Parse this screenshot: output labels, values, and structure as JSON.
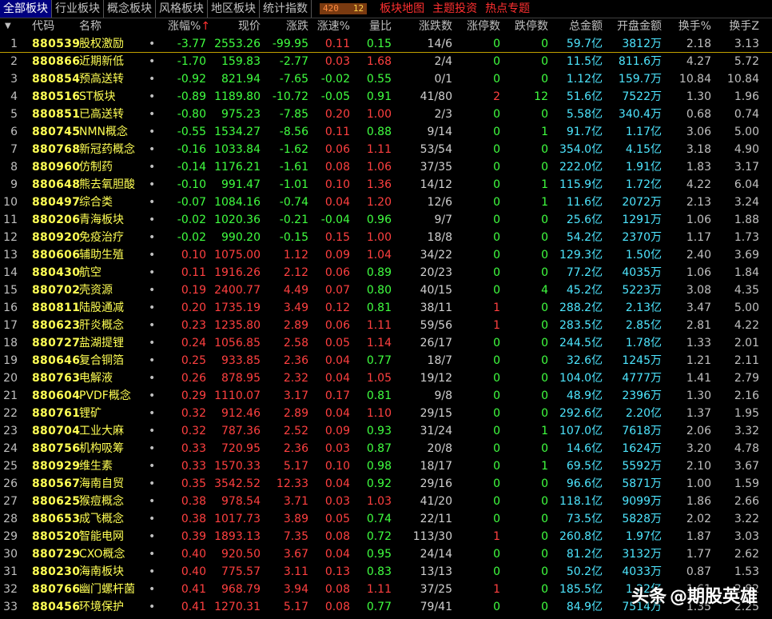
{
  "tabs": [
    "全部板块",
    "行业板块",
    "概念板块",
    "风格板块",
    "地区板块",
    "统计指数"
  ],
  "counter": {
    "a": "420",
    "b": "12"
  },
  "links": [
    "板块地图",
    "主题投资",
    "热点专题"
  ],
  "columns": {
    "code": "代码",
    "name": "名称",
    "pct": "涨幅%",
    "pct_arrow": "↑",
    "price": "现价",
    "chg": "涨跌",
    "spd": "涨速%",
    "vr": "量比",
    "cnt": "涨跌数",
    "ztm": "涨停数",
    "dtm": "跌停数",
    "amt": "总金额",
    "opn": "开盘金额",
    "hs": "换手%",
    "hs2": "换手Z",
    "caret": "▼"
  },
  "rows": [
    {
      "i": "1",
      "code": "880539",
      "name": "股权激励",
      "dot": "•",
      "pct": "-3.77",
      "price": "2553.26",
      "chg": "-99.95",
      "spd": "0.11",
      "vr": "0.15",
      "cnt": "14/6",
      "ztm": "0",
      "dtm": "0",
      "amt": "59.7亿",
      "opn": "3812万",
      "hs": "2.18",
      "hs2": "3.13"
    },
    {
      "i": "2",
      "code": "880866",
      "name": "近期新低",
      "dot": "•",
      "pct": "-1.70",
      "price": "159.83",
      "chg": "-2.77",
      "spd": "0.03",
      "vr": "1.68",
      "cnt": "2/4",
      "ztm": "0",
      "dtm": "0",
      "amt": "11.5亿",
      "opn": "811.6万",
      "hs": "4.27",
      "hs2": "5.72"
    },
    {
      "i": "3",
      "code": "880854",
      "name": "预高送转",
      "dot": "•",
      "pct": "-0.92",
      "price": "821.94",
      "chg": "-7.65",
      "spd": "-0.02",
      "vr": "0.55",
      "cnt": "0/1",
      "ztm": "0",
      "dtm": "0",
      "amt": "1.12亿",
      "opn": "159.7万",
      "hs": "10.84",
      "hs2": "10.84"
    },
    {
      "i": "4",
      "code": "880516",
      "name": "ST板块",
      "dot": "•",
      "pct": "-0.89",
      "price": "1189.80",
      "chg": "-10.72",
      "spd": "-0.05",
      "vr": "0.91",
      "cnt": "41/80",
      "ztm": "2",
      "dtm": "12",
      "amt": "51.6亿",
      "opn": "7522万",
      "hs": "1.30",
      "hs2": "1.96"
    },
    {
      "i": "5",
      "code": "880851",
      "name": "已高送转",
      "dot": "•",
      "pct": "-0.80",
      "price": "975.23",
      "chg": "-7.85",
      "spd": "0.20",
      "vr": "1.00",
      "cnt": "2/3",
      "ztm": "0",
      "dtm": "0",
      "amt": "5.58亿",
      "opn": "340.4万",
      "hs": "0.68",
      "hs2": "0.74"
    },
    {
      "i": "6",
      "code": "880745",
      "name": "NMN概念",
      "dot": "•",
      "pct": "-0.55",
      "price": "1534.27",
      "chg": "-8.56",
      "spd": "0.11",
      "vr": "0.88",
      "cnt": "9/14",
      "ztm": "0",
      "dtm": "1",
      "amt": "91.7亿",
      "opn": "1.17亿",
      "hs": "3.06",
      "hs2": "5.00"
    },
    {
      "i": "7",
      "code": "880768",
      "name": "新冠药概念",
      "dot": "•",
      "pct": "-0.16",
      "price": "1033.84",
      "chg": "-1.62",
      "spd": "0.06",
      "vr": "1.11",
      "cnt": "53/54",
      "ztm": "0",
      "dtm": "0",
      "amt": "354.0亿",
      "opn": "4.15亿",
      "hs": "3.18",
      "hs2": "4.90"
    },
    {
      "i": "8",
      "code": "880960",
      "name": "仿制药",
      "dot": "•",
      "pct": "-0.14",
      "price": "1176.21",
      "chg": "-1.61",
      "spd": "0.08",
      "vr": "1.06",
      "cnt": "37/35",
      "ztm": "0",
      "dtm": "0",
      "amt": "222.0亿",
      "opn": "1.91亿",
      "hs": "1.83",
      "hs2": "3.17"
    },
    {
      "i": "9",
      "code": "880648",
      "name": "熊去氧胆酸",
      "dot": "•",
      "pct": "-0.10",
      "price": "991.47",
      "chg": "-1.01",
      "spd": "0.10",
      "vr": "1.36",
      "cnt": "14/12",
      "ztm": "0",
      "dtm": "1",
      "amt": "115.9亿",
      "opn": "1.72亿",
      "hs": "4.22",
      "hs2": "6.04"
    },
    {
      "i": "10",
      "code": "880497",
      "name": "综合类",
      "dot": "•",
      "pct": "-0.07",
      "price": "1084.16",
      "chg": "-0.74",
      "spd": "0.04",
      "vr": "1.20",
      "cnt": "12/6",
      "ztm": "0",
      "dtm": "1",
      "amt": "11.6亿",
      "opn": "2072万",
      "hs": "2.13",
      "hs2": "3.24"
    },
    {
      "i": "11",
      "code": "880206",
      "name": "青海板块",
      "dot": "•",
      "pct": "-0.02",
      "price": "1020.36",
      "chg": "-0.21",
      "spd": "-0.04",
      "vr": "0.96",
      "cnt": "9/7",
      "ztm": "0",
      "dtm": "0",
      "amt": "25.6亿",
      "opn": "1291万",
      "hs": "1.06",
      "hs2": "1.88"
    },
    {
      "i": "12",
      "code": "880920",
      "name": "免疫治疗",
      "dot": "•",
      "pct": "-0.02",
      "price": "990.20",
      "chg": "-0.15",
      "spd": "0.15",
      "vr": "1.00",
      "cnt": "18/8",
      "ztm": "0",
      "dtm": "0",
      "amt": "54.2亿",
      "opn": "2370万",
      "hs": "1.17",
      "hs2": "1.73"
    },
    {
      "i": "13",
      "code": "880606",
      "name": "辅助生殖",
      "dot": "•",
      "pct": "0.10",
      "price": "1075.00",
      "chg": "1.12",
      "spd": "0.09",
      "vr": "1.04",
      "cnt": "34/22",
      "ztm": "0",
      "dtm": "0",
      "amt": "129.3亿",
      "opn": "1.50亿",
      "hs": "2.40",
      "hs2": "3.69"
    },
    {
      "i": "14",
      "code": "880430",
      "name": "航空",
      "dot": "•",
      "pct": "0.11",
      "price": "1916.26",
      "chg": "2.12",
      "spd": "0.06",
      "vr": "0.89",
      "cnt": "20/23",
      "ztm": "0",
      "dtm": "0",
      "amt": "77.2亿",
      "opn": "4035万",
      "hs": "1.06",
      "hs2": "1.84"
    },
    {
      "i": "15",
      "code": "880702",
      "name": "壳资源",
      "dot": "•",
      "pct": "0.19",
      "price": "2400.77",
      "chg": "4.49",
      "spd": "0.07",
      "vr": "0.80",
      "cnt": "40/15",
      "ztm": "0",
      "dtm": "4",
      "amt": "45.2亿",
      "opn": "5223万",
      "hs": "3.08",
      "hs2": "4.35"
    },
    {
      "i": "16",
      "code": "880811",
      "name": "陆股通减",
      "dot": "•",
      "pct": "0.20",
      "price": "1735.19",
      "chg": "3.49",
      "spd": "0.12",
      "vr": "0.81",
      "cnt": "38/11",
      "ztm": "1",
      "dtm": "0",
      "amt": "288.2亿",
      "opn": "2.13亿",
      "hs": "3.47",
      "hs2": "5.00"
    },
    {
      "i": "17",
      "code": "880623",
      "name": "肝炎概念",
      "dot": "•",
      "pct": "0.23",
      "price": "1235.80",
      "chg": "2.89",
      "spd": "0.06",
      "vr": "1.11",
      "cnt": "59/56",
      "ztm": "1",
      "dtm": "0",
      "amt": "283.5亿",
      "opn": "2.85亿",
      "hs": "2.81",
      "hs2": "4.22"
    },
    {
      "i": "18",
      "code": "880727",
      "name": "盐湖提锂",
      "dot": "•",
      "pct": "0.24",
      "price": "1056.85",
      "chg": "2.58",
      "spd": "0.05",
      "vr": "1.14",
      "cnt": "26/17",
      "ztm": "0",
      "dtm": "0",
      "amt": "244.5亿",
      "opn": "1.78亿",
      "hs": "1.33",
      "hs2": "2.01"
    },
    {
      "i": "19",
      "code": "880646",
      "name": "复合铜箔",
      "dot": "•",
      "pct": "0.25",
      "price": "933.85",
      "chg": "2.36",
      "spd": "0.04",
      "vr": "0.77",
      "cnt": "18/7",
      "ztm": "0",
      "dtm": "0",
      "amt": "32.6亿",
      "opn": "1245万",
      "hs": "1.21",
      "hs2": "2.11"
    },
    {
      "i": "20",
      "code": "880763",
      "name": "电解液",
      "dot": "•",
      "pct": "0.26",
      "price": "878.95",
      "chg": "2.32",
      "spd": "0.04",
      "vr": "1.05",
      "cnt": "19/12",
      "ztm": "0",
      "dtm": "0",
      "amt": "104.0亿",
      "opn": "4777万",
      "hs": "1.41",
      "hs2": "2.79"
    },
    {
      "i": "21",
      "code": "880604",
      "name": "PVDF概念",
      "dot": "•",
      "pct": "0.29",
      "price": "1110.07",
      "chg": "3.17",
      "spd": "0.17",
      "vr": "0.81",
      "cnt": "9/8",
      "ztm": "0",
      "dtm": "0",
      "amt": "48.9亿",
      "opn": "2396万",
      "hs": "1.30",
      "hs2": "2.16"
    },
    {
      "i": "22",
      "code": "880761",
      "name": "锂矿",
      "dot": "•",
      "pct": "0.32",
      "price": "912.46",
      "chg": "2.89",
      "spd": "0.04",
      "vr": "1.10",
      "cnt": "29/15",
      "ztm": "0",
      "dtm": "0",
      "amt": "292.6亿",
      "opn": "2.20亿",
      "hs": "1.37",
      "hs2": "1.95"
    },
    {
      "i": "23",
      "code": "880704",
      "name": "工业大麻",
      "dot": "•",
      "pct": "0.32",
      "price": "787.36",
      "chg": "2.52",
      "spd": "0.09",
      "vr": "0.93",
      "cnt": "31/24",
      "ztm": "0",
      "dtm": "1",
      "amt": "107.0亿",
      "opn": "7618万",
      "hs": "2.06",
      "hs2": "3.32"
    },
    {
      "i": "24",
      "code": "880756",
      "name": "机构吸筹",
      "dot": "•",
      "pct": "0.33",
      "price": "720.95",
      "chg": "2.36",
      "spd": "0.03",
      "vr": "0.87",
      "cnt": "20/8",
      "ztm": "0",
      "dtm": "0",
      "amt": "14.6亿",
      "opn": "1624万",
      "hs": "3.20",
      "hs2": "4.78"
    },
    {
      "i": "25",
      "code": "880929",
      "name": "维生素",
      "dot": "•",
      "pct": "0.33",
      "price": "1570.33",
      "chg": "5.17",
      "spd": "0.10",
      "vr": "0.98",
      "cnt": "18/17",
      "ztm": "0",
      "dtm": "1",
      "amt": "69.5亿",
      "opn": "5592万",
      "hs": "2.10",
      "hs2": "3.67"
    },
    {
      "i": "26",
      "code": "880567",
      "name": "海南自贸",
      "dot": "•",
      "pct": "0.35",
      "price": "3542.52",
      "chg": "12.33",
      "spd": "0.04",
      "vr": "0.92",
      "cnt": "29/16",
      "ztm": "0",
      "dtm": "0",
      "amt": "96.6亿",
      "opn": "5871万",
      "hs": "1.00",
      "hs2": "1.59"
    },
    {
      "i": "27",
      "code": "880625",
      "name": "猴痘概念",
      "dot": "•",
      "pct": "0.38",
      "price": "978.54",
      "chg": "3.71",
      "spd": "0.03",
      "vr": "1.03",
      "cnt": "41/20",
      "ztm": "0",
      "dtm": "0",
      "amt": "118.1亿",
      "opn": "9099万",
      "hs": "1.86",
      "hs2": "2.66"
    },
    {
      "i": "28",
      "code": "880653",
      "name": "成飞概念",
      "dot": "•",
      "pct": "0.38",
      "price": "1017.73",
      "chg": "3.89",
      "spd": "0.05",
      "vr": "0.74",
      "cnt": "22/11",
      "ztm": "0",
      "dtm": "0",
      "amt": "73.5亿",
      "opn": "5828万",
      "hs": "2.02",
      "hs2": "3.22"
    },
    {
      "i": "29",
      "code": "880520",
      "name": "智能电网",
      "dot": "•",
      "pct": "0.39",
      "price": "1893.13",
      "chg": "7.35",
      "spd": "0.08",
      "vr": "0.72",
      "cnt": "113/30",
      "ztm": "1",
      "dtm": "0",
      "amt": "260.8亿",
      "opn": "1.97亿",
      "hs": "1.87",
      "hs2": "3.03"
    },
    {
      "i": "30",
      "code": "880729",
      "name": "CXO概念",
      "dot": "•",
      "pct": "0.40",
      "price": "920.50",
      "chg": "3.67",
      "spd": "0.04",
      "vr": "0.95",
      "cnt": "24/14",
      "ztm": "0",
      "dtm": "0",
      "amt": "81.2亿",
      "opn": "3132万",
      "hs": "1.77",
      "hs2": "2.62"
    },
    {
      "i": "31",
      "code": "880230",
      "name": "海南板块",
      "dot": "•",
      "pct": "0.40",
      "price": "775.57",
      "chg": "3.11",
      "spd": "0.13",
      "vr": "0.83",
      "cnt": "13/13",
      "ztm": "0",
      "dtm": "0",
      "amt": "50.2亿",
      "opn": "4033万",
      "hs": "0.87",
      "hs2": "1.53"
    },
    {
      "i": "32",
      "code": "880766",
      "name": "幽门螺杆菌",
      "dot": "•",
      "pct": "0.41",
      "price": "968.79",
      "chg": "3.94",
      "spd": "0.08",
      "vr": "1.11",
      "cnt": "37/25",
      "ztm": "1",
      "dtm": "0",
      "amt": "185.5亿",
      "opn": "1.22亿",
      "hs": "1.61",
      "hs2": "2.82"
    },
    {
      "i": "33",
      "code": "880456",
      "name": "环境保护",
      "dot": "•",
      "pct": "0.41",
      "price": "1270.31",
      "chg": "5.17",
      "spd": "0.08",
      "vr": "0.77",
      "cnt": "79/41",
      "ztm": "0",
      "dtm": "0",
      "amt": "84.9亿",
      "opn": "7514万",
      "hs": "1.35",
      "hs2": "2.25"
    }
  ],
  "watermark": {
    "icon": "头条",
    "text": "@期股英雄"
  },
  "colors": {
    "up": "#ff4040",
    "down": "#40ff40",
    "code": "#ffff54",
    "amount": "#4ee6ff",
    "tab_active": "#000080"
  }
}
